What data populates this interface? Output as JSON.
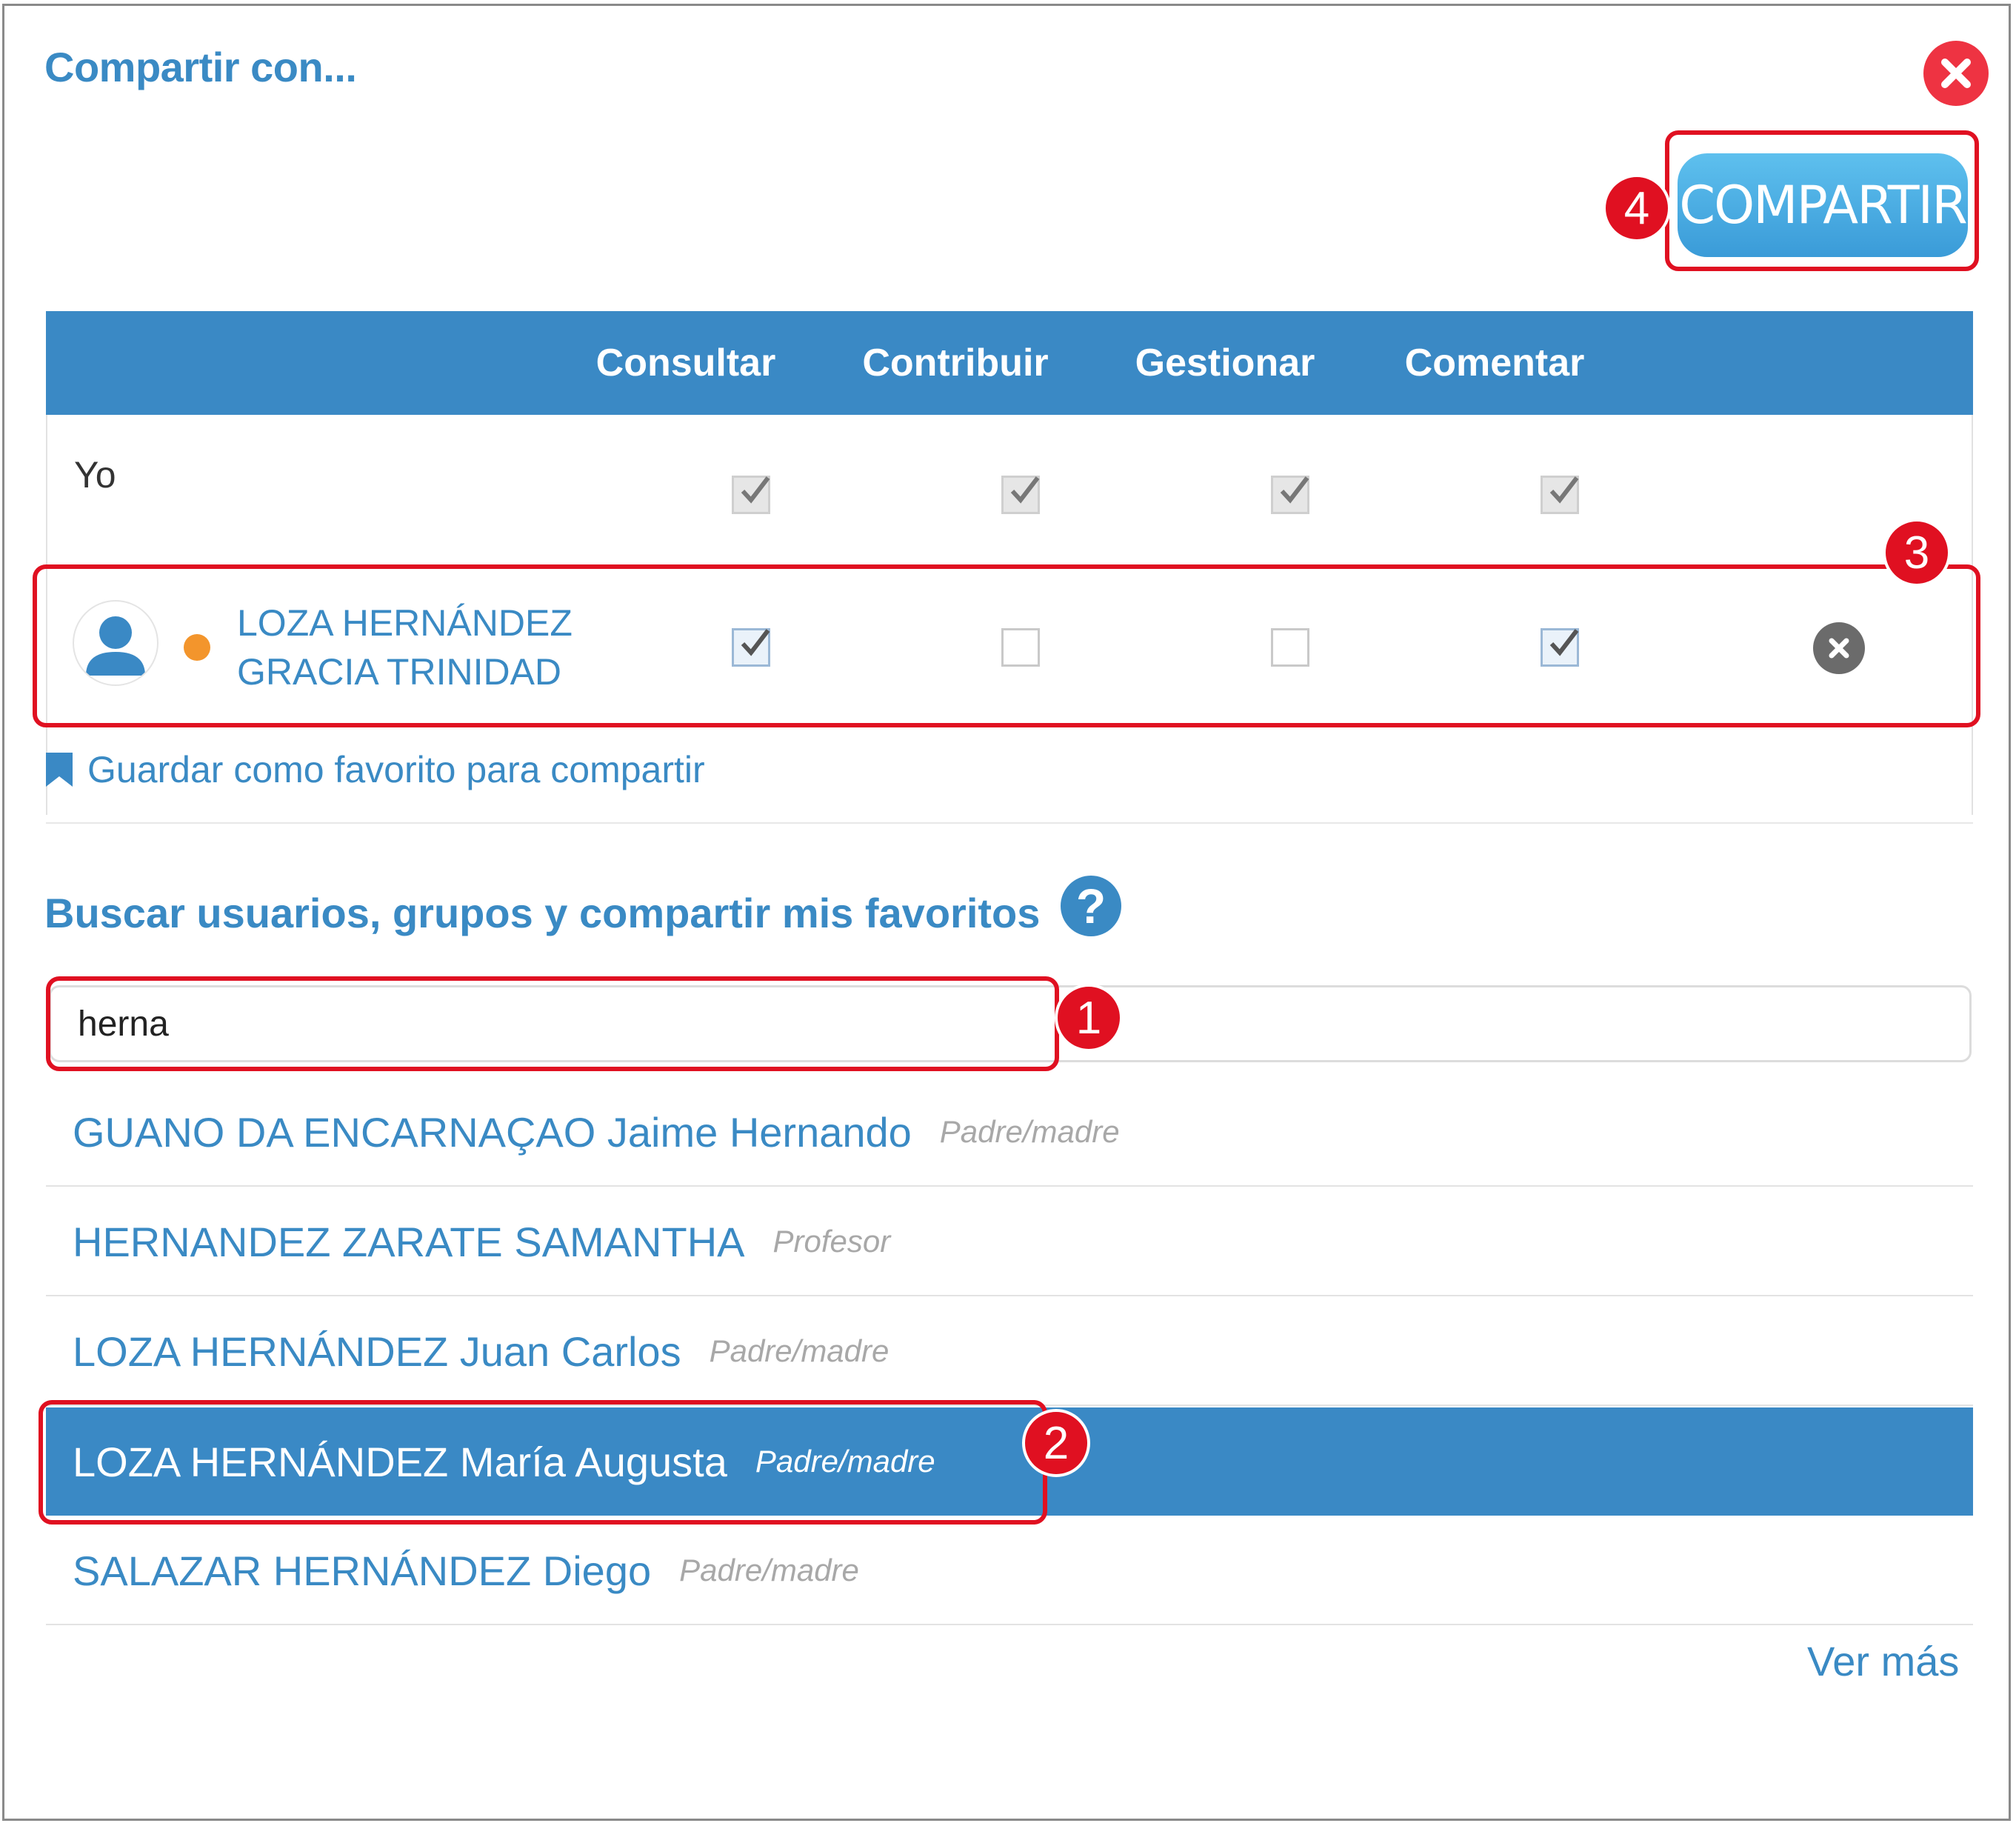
{
  "dialog": {
    "title": "Compartir con...",
    "share_label": "COMPARTIR",
    "close_icon": "close-icon"
  },
  "permissions": {
    "columns": [
      "Consultar",
      "Contribuir",
      "Gestionar",
      "Comentar"
    ],
    "me": {
      "label": "Yo",
      "checked": [
        true,
        true,
        true,
        true
      ],
      "disabled": true
    },
    "shared_user": {
      "name_line1": "LOZA HERNÁNDEZ",
      "name_line2": "GRACIA TRINIDAD",
      "status_color": "#f3952c",
      "checked": [
        true,
        false,
        false,
        true
      ]
    }
  },
  "favorite_link": "Guardar como favorito para compartir",
  "search": {
    "title": "Buscar usuarios, grupos y compartir mis favoritos",
    "help_label": "?",
    "value": "herna",
    "results": [
      {
        "name": "GUANO DA ENCARNAÇAO Jaime Hernando",
        "role": "Padre/madre",
        "selected": false
      },
      {
        "name": "HERNANDEZ ZARATE SAMANTHA",
        "role": "Profesor",
        "selected": false
      },
      {
        "name": "LOZA HERNÁNDEZ Juan Carlos",
        "role": "Padre/madre",
        "selected": false
      },
      {
        "name": "LOZA HERNÁNDEZ María Augusta",
        "role": "Padre/madre",
        "selected": true
      },
      {
        "name": "SALAZAR HERNÁNDEZ Diego",
        "role": "Padre/madre",
        "selected": false
      }
    ],
    "more_label": "Ver más"
  },
  "annotations": [
    "1",
    "2",
    "3",
    "4"
  ],
  "colors": {
    "accent": "#3a89c5",
    "close": "#ee3342",
    "annotation": "#e01021"
  }
}
